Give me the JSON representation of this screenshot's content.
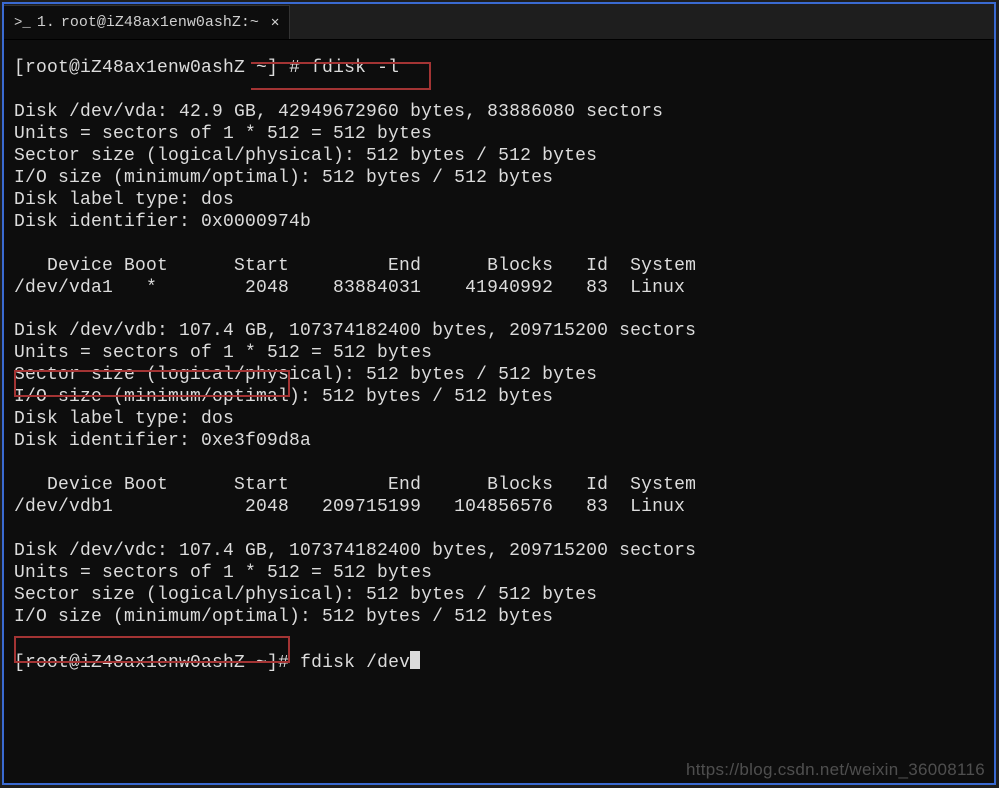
{
  "tab": {
    "number": "1.",
    "title": "root@iZ48ax1enw0ashZ:~"
  },
  "prompt": {
    "user_host": "[root@iZ48ax1enw0ashZ ~]",
    "hash": "#"
  },
  "cmd1": "fdisk -l",
  "vda": {
    "header": "Disk /dev/vda: 42.9 GB, 42949672960 bytes, 83886080 sectors",
    "units": "Units = sectors of 1 * 512 = 512 bytes",
    "sector": "Sector size (logical/physical): 512 bytes / 512 bytes",
    "io": "I/O size (minimum/optimal): 512 bytes / 512 bytes",
    "label": "Disk label type: dos",
    "id": "Disk identifier: 0x0000974b",
    "table_head": "   Device Boot      Start         End      Blocks   Id  System",
    "table_row": "/dev/vda1   *        2048    83884031    41940992   83  Linux"
  },
  "vdb": {
    "header": "Disk /dev/vdb: 107.4 GB, 107374182400 bytes, 209715200 sectors",
    "units": "Units = sectors of 1 * 512 = 512 bytes",
    "sector": "Sector size (logical/physical): 512 bytes / 512 bytes",
    "io": "I/O size (minimum/optimal): 512 bytes / 512 bytes",
    "label": "Disk label type: dos",
    "id": "Disk identifier: 0xe3f09d8a",
    "table_head": "   Device Boot      Start         End      Blocks   Id  System",
    "table_row": "/dev/vdb1            2048   209715199   104856576   83  Linux"
  },
  "vdc": {
    "header": "Disk /dev/vdc: 107.4 GB, 107374182400 bytes, 209715200 sectors",
    "units": "Units = sectors of 1 * 512 = 512 bytes",
    "sector": "Sector size (logical/physical): 512 bytes / 512 bytes",
    "io": "I/O size (minimum/optimal): 512 bytes / 512 bytes"
  },
  "cmd2": "fdisk /dev",
  "watermark": "https://blog.csdn.net/weixin_36008116"
}
